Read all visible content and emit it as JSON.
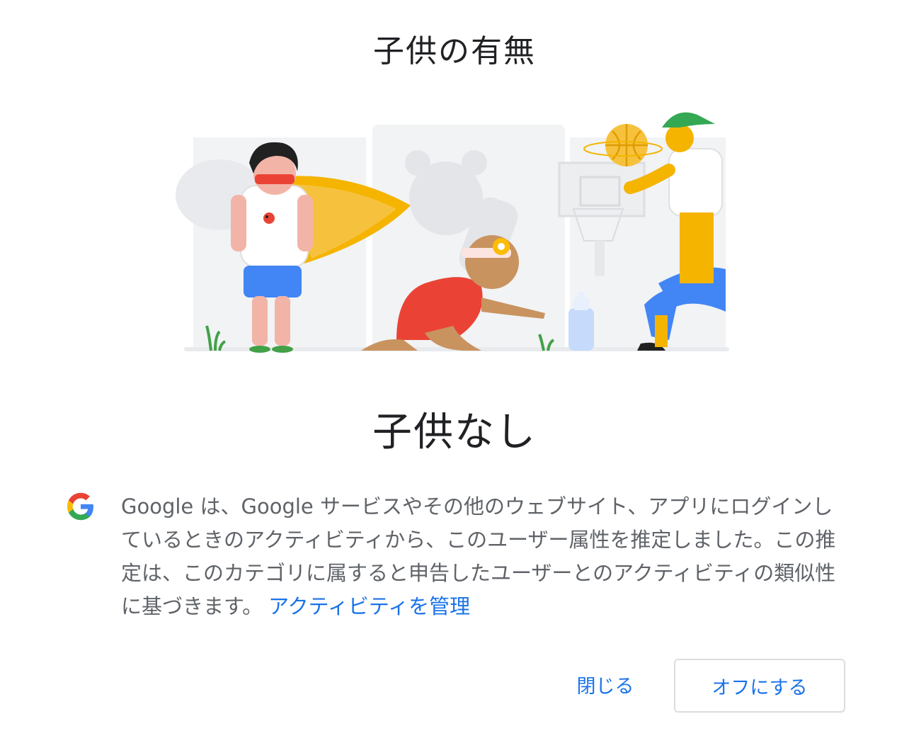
{
  "dialog": {
    "title": "子供の有無",
    "value": "子供なし",
    "description_text": "Google は、Google サービスやその他のウェブサイト、アプリにログインしているときのアクティビティから、このユーザー属性を推定しました。この推定は、このカテゴリに属すると申告したユーザーとのアクティビティの類似性に基づきます。",
    "manage_link": "アクティビティを管理",
    "logo_icon": "google-g-icon",
    "illustration_icon": "children-illustration"
  },
  "buttons": {
    "close_label": "閉じる",
    "off_label": "オフにする"
  },
  "colors": {
    "accent": "#1a73e8",
    "text_primary": "#202124",
    "text_secondary": "#5f6368"
  }
}
